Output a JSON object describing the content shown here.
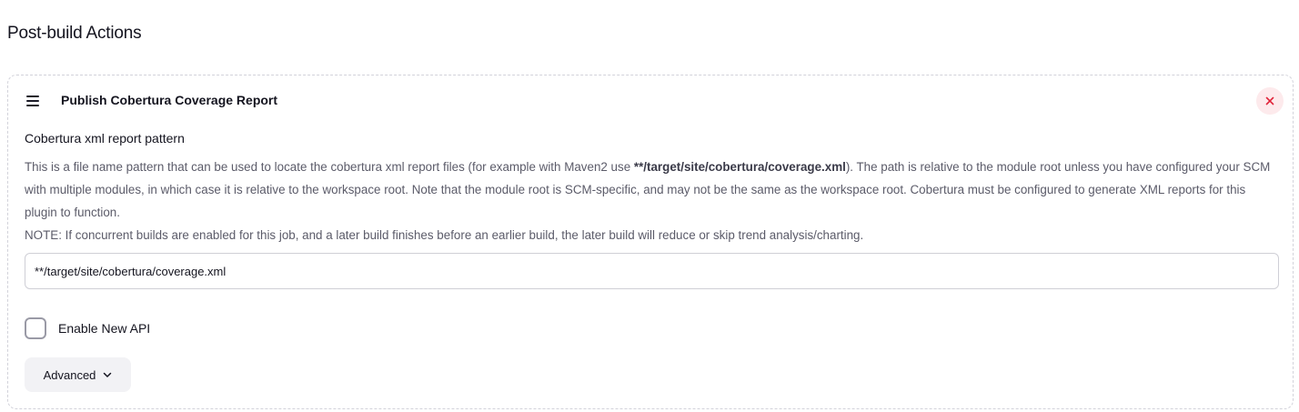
{
  "section": {
    "title": "Post-build Actions"
  },
  "card": {
    "title": "Publish Cobertura Coverage Report",
    "drag_icon": "drag-handle-icon",
    "close_icon": "close-icon",
    "close_bg": "#fdeaec",
    "close_color": "#e0243a"
  },
  "field": {
    "label": "Cobertura xml report pattern",
    "help": {
      "line1_prefix": "This is a file name pattern that can be used to locate the cobertura xml report files (for example with Maven2 use ",
      "line1_bold": "**/target/site/cobertura/coverage.xml",
      "line1_suffix": "). The path is relative to the module root unless you have configured your SCM with multiple modules, in which case it is relative to the workspace root. Note that the module root is SCM-specific, and may not be the same as the workspace root. Cobertura must be configured to generate XML reports for this plugin to function.",
      "note": "NOTE: If concurrent builds are enabled for this job, and a later build finishes before an earlier build, the later build will reduce or skip trend analysis/charting."
    },
    "value": "**/target/site/cobertura/coverage.xml"
  },
  "checkbox": {
    "label": "Enable New API",
    "checked": false
  },
  "advanced": {
    "label": "Advanced",
    "icon": "chevron-down-icon"
  }
}
